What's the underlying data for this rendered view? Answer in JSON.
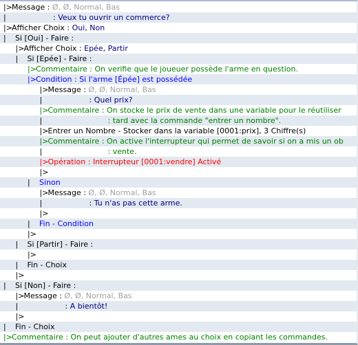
{
  "colors": {
    "row_alt_bg": "#e3e9f0",
    "text": "#000000",
    "params": "#a0a0a0",
    "message_text": "#000080",
    "condition": "#0000ff",
    "comment": "#008000",
    "operation": "#ff0000"
  },
  "event_commands": [
    {
      "indent": 0,
      "prefix": "|> ",
      "parts": [
        {
          "t": "Message : ",
          "c": "black"
        },
        {
          "t": "Ø, Ø, Normal, Bas",
          "c": "gray"
        }
      ]
    },
    {
      "indent": 0,
      "prefix": "|",
      "cont": "message",
      "parts": [
        {
          "t": ": Veux tu ouvrir un commerce?",
          "c": "navy"
        }
      ]
    },
    {
      "indent": 0,
      "prefix": "|> ",
      "parts": [
        {
          "t": "Afficher Choix : ",
          "c": "black"
        },
        {
          "t": "Oui, Non",
          "c": "navy"
        }
      ]
    },
    {
      "indent": 0,
      "prefix": "|",
      "branch": true,
      "parts": [
        {
          "t": "Si [Oui] - Faire :",
          "c": "black"
        }
      ]
    },
    {
      "indent": 1,
      "prefix": "|> ",
      "parts": [
        {
          "t": "Afficher Choix : ",
          "c": "black"
        },
        {
          "t": "Epée, Partir",
          "c": "navy"
        }
      ]
    },
    {
      "indent": 1,
      "prefix": "|",
      "branch": true,
      "parts": [
        {
          "t": "Si [Epée] - Faire :",
          "c": "black"
        }
      ]
    },
    {
      "indent": 2,
      "prefix": "|> ",
      "pc": "green",
      "parts": [
        {
          "t": "Commentaire : On verifie que le joueuer possède l'arme en question.",
          "c": "green"
        }
      ]
    },
    {
      "indent": 2,
      "prefix": "|> ",
      "pc": "blue",
      "parts": [
        {
          "t": "Condition : Si l'arme [Épée] est possédée",
          "c": "blue"
        }
      ]
    },
    {
      "indent": 3,
      "prefix": "|> ",
      "parts": [
        {
          "t": "Message : ",
          "c": "black"
        },
        {
          "t": "Ø, Ø, Normal, Bas",
          "c": "gray"
        }
      ]
    },
    {
      "indent": 3,
      "prefix": "|",
      "cont": "message",
      "parts": [
        {
          "t": ": Quel prix?",
          "c": "navy"
        }
      ]
    },
    {
      "indent": 3,
      "prefix": "|> ",
      "pc": "green",
      "parts": [
        {
          "t": "Commentaire : On stocke le prix de vente dans une variable pour le réutiliser",
          "c": "green"
        }
      ]
    },
    {
      "indent": 3,
      "prefix": "|",
      "cont": "comment",
      "parts": [
        {
          "t": ": tard avec la commande \"entrer un nombre\".",
          "c": "green"
        }
      ]
    },
    {
      "indent": 3,
      "prefix": "|> ",
      "parts": [
        {
          "t": "Entrer un Nombre - Stocker dans la variable [0001:prix], 3 Chiffre(s)",
          "c": "black"
        }
      ]
    },
    {
      "indent": 3,
      "prefix": "|> ",
      "pc": "green",
      "parts": [
        {
          "t": "Commentaire : On active l'interrupteur qui permet de savoir si on a mis un ob",
          "c": "green"
        }
      ]
    },
    {
      "indent": 3,
      "prefix": "|",
      "cont": "comment",
      "parts": [
        {
          "t": ": vente.",
          "c": "green"
        }
      ]
    },
    {
      "indent": 3,
      "prefix": "|> ",
      "pc": "red",
      "parts": [
        {
          "t": "Opération : Interrupteur [0001:vendre] Activé",
          "c": "red"
        }
      ]
    },
    {
      "indent": 3,
      "prefix": "|>",
      "parts": []
    },
    {
      "indent": 2,
      "prefix": "|",
      "branch": true,
      "parts": [
        {
          "t": "Sinon",
          "c": "blue"
        }
      ]
    },
    {
      "indent": 3,
      "prefix": "|> ",
      "parts": [
        {
          "t": "Message : ",
          "c": "black"
        },
        {
          "t": "Ø, Ø, Normal, Bas",
          "c": "gray"
        }
      ]
    },
    {
      "indent": 3,
      "prefix": "|",
      "cont": "message",
      "parts": [
        {
          "t": ": Tu n'as pas cette arme.",
          "c": "navy"
        }
      ]
    },
    {
      "indent": 3,
      "prefix": "|>",
      "parts": []
    },
    {
      "indent": 2,
      "prefix": "|",
      "branch": true,
      "parts": [
        {
          "t": "Fin - Condition",
          "c": "blue"
        }
      ]
    },
    {
      "indent": 2,
      "prefix": "|>",
      "parts": []
    },
    {
      "indent": 1,
      "prefix": "|",
      "branch": true,
      "parts": [
        {
          "t": "Si [Partir] - Faire :",
          "c": "black"
        }
      ]
    },
    {
      "indent": 2,
      "prefix": "|>",
      "parts": []
    },
    {
      "indent": 1,
      "prefix": "|",
      "branch": true,
      "parts": [
        {
          "t": "Fin - Choix",
          "c": "black"
        }
      ]
    },
    {
      "indent": 1,
      "prefix": "|>",
      "parts": []
    },
    {
      "indent": 0,
      "prefix": "|",
      "branch": true,
      "parts": [
        {
          "t": "Si [Non] - Faire :",
          "c": "black"
        }
      ]
    },
    {
      "indent": 1,
      "prefix": "|> ",
      "parts": [
        {
          "t": "Message : ",
          "c": "black"
        },
        {
          "t": "Ø, Ø, Normal, Bas",
          "c": "gray"
        }
      ]
    },
    {
      "indent": 1,
      "prefix": "|",
      "cont": "message",
      "parts": [
        {
          "t": ": A bientôt!",
          "c": "navy"
        }
      ]
    },
    {
      "indent": 1,
      "prefix": "|>",
      "parts": []
    },
    {
      "indent": 0,
      "prefix": "|",
      "branch": true,
      "parts": [
        {
          "t": "Fin - Choix",
          "c": "black"
        }
      ]
    },
    {
      "indent": 0,
      "prefix": "|> ",
      "pc": "green",
      "parts": [
        {
          "t": "Commentaire : On peut ajouter d'autres ames au choix en copiant les commandes.",
          "c": "green"
        }
      ]
    }
  ]
}
